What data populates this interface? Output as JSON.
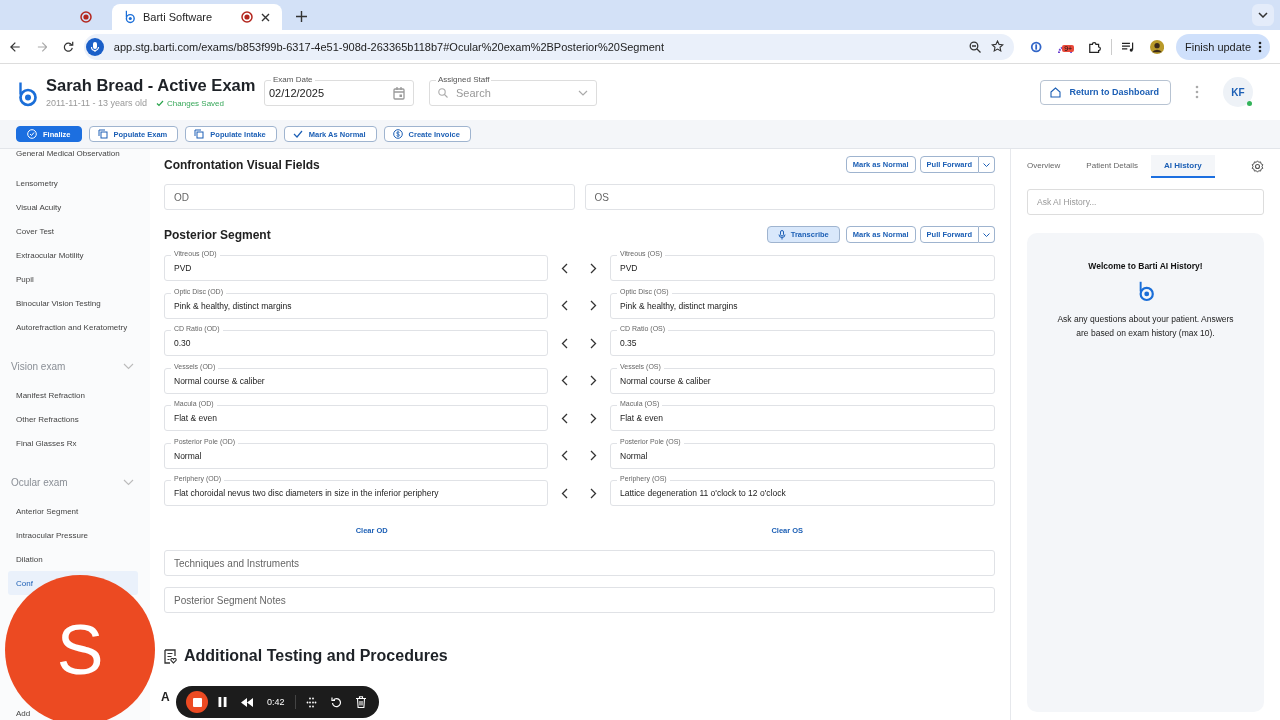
{
  "browser": {
    "tabs": [
      {
        "selected": false
      },
      {
        "title": "Barti Software",
        "selected": true
      }
    ],
    "url": "app.stg.barti.com/exams/b853f99b-6317-4e51-908d-263365b118b7#Ocular%20exam%2BPosterior%20Segment",
    "extension_badge": "9+",
    "update_button": "Finish update"
  },
  "header": {
    "title": "Sarah Bread - Active Exam",
    "subtitle": "2011-11-11 - 13 years old",
    "status": "Changes Saved",
    "exam_date": {
      "label": "Exam Date",
      "value": "02/12/2025"
    },
    "assigned_staff": {
      "label": "Assigned Staff",
      "placeholder": "Search"
    },
    "return_button": "Return to Dashboard",
    "avatar": {
      "initials": "KF",
      "online": true
    }
  },
  "actions": [
    {
      "label": "Finalize",
      "primary": true
    },
    {
      "label": "Populate Exam",
      "primary": false
    },
    {
      "label": "Populate Intake",
      "primary": false
    },
    {
      "label": "Mark As Normal",
      "primary": false
    },
    {
      "label": "Create Invoice",
      "primary": false
    }
  ],
  "sidebar": {
    "entries": [
      {
        "kind": "item",
        "label": "General Medical Observation",
        "selected": false
      },
      {
        "kind": "item",
        "label": "Lensometry",
        "selected": false
      },
      {
        "kind": "item",
        "label": "Visual Acuity",
        "selected": false
      },
      {
        "kind": "item",
        "label": "Cover Test",
        "selected": false
      },
      {
        "kind": "item",
        "label": "Extraocular Motility",
        "selected": false
      },
      {
        "kind": "item",
        "label": "Pupil",
        "selected": false
      },
      {
        "kind": "item",
        "label": "Binocular Vision Testing",
        "selected": false
      },
      {
        "kind": "item",
        "label": "Autorefraction and Keratometry",
        "selected": false
      },
      {
        "kind": "group",
        "label": "Vision exam",
        "expanded": true
      },
      {
        "kind": "item",
        "label": "Manifest Refraction",
        "selected": false
      },
      {
        "kind": "item",
        "label": "Other Refractions",
        "selected": false
      },
      {
        "kind": "item",
        "label": "Final Glasses Rx",
        "selected": false
      },
      {
        "kind": "group",
        "label": "Ocular exam",
        "expanded": true
      },
      {
        "kind": "item",
        "label": "Anterior Segment",
        "selected": false
      },
      {
        "kind": "item",
        "label": "Intraocular Pressure",
        "selected": false
      },
      {
        "kind": "item",
        "label": "Dilation",
        "selected": false
      },
      {
        "kind": "item",
        "label": "Conf",
        "selected": true
      },
      {
        "kind": "item",
        "label": "Add",
        "selected": false
      }
    ]
  },
  "confrontation_visual_fields": {
    "title": "Confrontation Visual Fields",
    "mark_normal": "Mark as Normal",
    "pull_forward": "Pull Forward",
    "od_placeholder": "OD",
    "os_placeholder": "OS"
  },
  "posterior_segment": {
    "title": "Posterior Segment",
    "transcribe": {
      "label": "Transcribe",
      "active": true
    },
    "mark_normal": "Mark as Normal",
    "pull_forward": "Pull Forward",
    "rows": [
      {
        "od_label": "Vitreous (OD)",
        "od_value": "PVD",
        "os_label": "Vitreous (OS)",
        "os_value": "PVD"
      },
      {
        "od_label": "Optic Disc (OD)",
        "od_value": "Pink & healthy, distinct margins",
        "os_label": "Optic Disc (OS)",
        "os_value": "Pink & healthy, distinct margins"
      },
      {
        "od_label": "CD Ratio (OD)",
        "od_value": "0.30",
        "os_label": "CD Ratio (OS)",
        "os_value": "0.35"
      },
      {
        "od_label": "Vessels (OD)",
        "od_value": "Normal course & caliber",
        "os_label": "Vessels (OS)",
        "os_value": "Normal course & caliber"
      },
      {
        "od_label": "Macula (OD)",
        "od_value": "Flat & even",
        "os_label": "Macula (OS)",
        "os_value": "Flat & even"
      },
      {
        "od_label": "Posterior Pole (OD)",
        "od_value": "Normal",
        "os_label": "Posterior Pole (OS)",
        "os_value": "Normal"
      },
      {
        "od_label": "Periphery (OD)",
        "od_value": "Flat choroidal nevus two disc diameters in size in the inferior periphery",
        "os_label": "Periphery (OS)",
        "os_value": "Lattice degeneration 11 o'clock to 12 o'clock"
      }
    ],
    "clear_od": "Clear OD",
    "clear_os": "Clear OS",
    "fields": [
      {
        "placeholder": "Techniques and Instruments"
      },
      {
        "placeholder": "Posterior Segment Notes"
      }
    ]
  },
  "additional": {
    "title": "Additional Testing and Procedures",
    "subheading": "A"
  },
  "right_panel": {
    "tabs": [
      {
        "label": "Overview",
        "selected": false
      },
      {
        "label": "Patient Details",
        "selected": false
      },
      {
        "label": "AI History",
        "selected": true
      }
    ],
    "search": {
      "placeholder": "Ask AI History..."
    },
    "welcome": {
      "title": "Welcome to Barti AI History!",
      "text": "Ask any questions about your patient. Answers are based on exam history (max 10)."
    }
  },
  "overlay": {
    "camera_initial": "S",
    "recorder": {
      "time": "0:42"
    }
  }
}
